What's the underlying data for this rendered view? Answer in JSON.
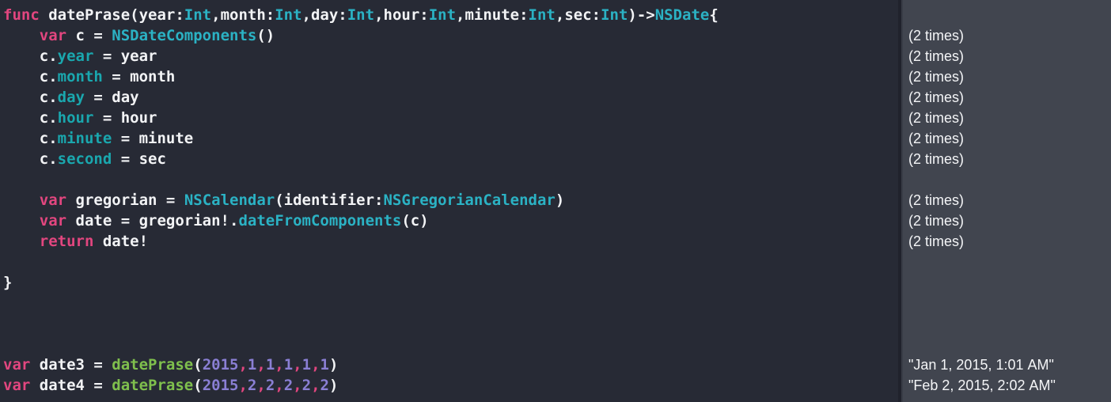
{
  "window": {
    "kind": "swift-playground",
    "editor_background": "#272a35",
    "sidebar_background": "#41454f",
    "divider_color": "#20222c"
  },
  "theme": {
    "keyword": "#e2467f",
    "type": "#2bb2c4",
    "property": "#1aa7ae",
    "function_call": "#7fbf4d",
    "number": "#8a7fd4",
    "plain_text": "#f2f3f5",
    "result_text": "#f4f5f7"
  },
  "editor": {
    "language": "Swift",
    "lines": [
      {
        "n": 1,
        "indent": 0,
        "tokens": [
          {
            "t": "func",
            "c": "kw"
          },
          {
            "t": " datePrase(year:",
            "c": "plain"
          },
          {
            "t": "Int",
            "c": "type"
          },
          {
            "t": ",month:",
            "c": "plain"
          },
          {
            "t": "Int",
            "c": "type"
          },
          {
            "t": ",day:",
            "c": "plain"
          },
          {
            "t": "Int",
            "c": "type"
          },
          {
            "t": ",hour:",
            "c": "plain"
          },
          {
            "t": "Int",
            "c": "type"
          },
          {
            "t": ",minute:",
            "c": "plain"
          },
          {
            "t": "Int",
            "c": "type"
          },
          {
            "t": ",sec:",
            "c": "plain"
          },
          {
            "t": "Int",
            "c": "type"
          },
          {
            "t": ")->",
            "c": "plain"
          },
          {
            "t": "NSDate",
            "c": "type"
          },
          {
            "t": "{",
            "c": "plain"
          }
        ]
      },
      {
        "n": 2,
        "indent": 4,
        "tokens": [
          {
            "t": "var",
            "c": "kw"
          },
          {
            "t": " c = ",
            "c": "plain"
          },
          {
            "t": "NSDateComponents",
            "c": "type"
          },
          {
            "t": "()",
            "c": "plain"
          }
        ]
      },
      {
        "n": 3,
        "indent": 4,
        "tokens": [
          {
            "t": "c.",
            "c": "plain"
          },
          {
            "t": "year",
            "c": "prop"
          },
          {
            "t": " = year",
            "c": "plain"
          }
        ]
      },
      {
        "n": 4,
        "indent": 4,
        "tokens": [
          {
            "t": "c.",
            "c": "plain"
          },
          {
            "t": "month",
            "c": "prop"
          },
          {
            "t": " = month",
            "c": "plain"
          }
        ]
      },
      {
        "n": 5,
        "indent": 4,
        "tokens": [
          {
            "t": "c.",
            "c": "plain"
          },
          {
            "t": "day",
            "c": "prop"
          },
          {
            "t": " = day",
            "c": "plain"
          }
        ]
      },
      {
        "n": 6,
        "indent": 4,
        "tokens": [
          {
            "t": "c.",
            "c": "plain"
          },
          {
            "t": "hour",
            "c": "prop"
          },
          {
            "t": " = hour",
            "c": "plain"
          }
        ]
      },
      {
        "n": 7,
        "indent": 4,
        "tokens": [
          {
            "t": "c.",
            "c": "plain"
          },
          {
            "t": "minute",
            "c": "prop"
          },
          {
            "t": " = minute",
            "c": "plain"
          }
        ]
      },
      {
        "n": 8,
        "indent": 4,
        "tokens": [
          {
            "t": "c.",
            "c": "plain"
          },
          {
            "t": "second",
            "c": "prop"
          },
          {
            "t": " = sec",
            "c": "plain"
          }
        ]
      },
      {
        "n": 9,
        "indent": 0,
        "tokens": []
      },
      {
        "n": 10,
        "indent": 4,
        "tokens": [
          {
            "t": "var",
            "c": "kw"
          },
          {
            "t": " gregorian = ",
            "c": "plain"
          },
          {
            "t": "NSCalendar",
            "c": "type"
          },
          {
            "t": "(identifier:",
            "c": "plain"
          },
          {
            "t": "NSGregorianCalendar",
            "c": "type"
          },
          {
            "t": ")",
            "c": "plain"
          }
        ]
      },
      {
        "n": 11,
        "indent": 4,
        "tokens": [
          {
            "t": "var",
            "c": "kw"
          },
          {
            "t": " date = gregorian!.",
            "c": "plain"
          },
          {
            "t": "dateFromComponents",
            "c": "type"
          },
          {
            "t": "(c)",
            "c": "plain"
          }
        ]
      },
      {
        "n": 12,
        "indent": 4,
        "tokens": [
          {
            "t": "return",
            "c": "kw"
          },
          {
            "t": " date!",
            "c": "plain"
          }
        ]
      },
      {
        "n": 13,
        "indent": 0,
        "tokens": []
      },
      {
        "n": 14,
        "indent": 0,
        "tokens": [
          {
            "t": "}",
            "c": "plain"
          }
        ]
      },
      {
        "n": 15,
        "indent": 0,
        "tokens": []
      },
      {
        "n": 16,
        "indent": 0,
        "tokens": []
      },
      {
        "n": 17,
        "indent": 0,
        "tokens": []
      },
      {
        "n": 18,
        "indent": 0,
        "tokens": [
          {
            "t": "var",
            "c": "kw"
          },
          {
            "t": " date3 = ",
            "c": "plain"
          },
          {
            "t": "datePrase",
            "c": "call"
          },
          {
            "t": "(",
            "c": "plain"
          },
          {
            "t": "2015",
            "c": "num"
          },
          {
            "t": ",",
            "c": "comma"
          },
          {
            "t": "1",
            "c": "num"
          },
          {
            "t": ",",
            "c": "comma"
          },
          {
            "t": "1",
            "c": "num"
          },
          {
            "t": ",",
            "c": "comma"
          },
          {
            "t": "1",
            "c": "num"
          },
          {
            "t": ",",
            "c": "comma"
          },
          {
            "t": "1",
            "c": "num"
          },
          {
            "t": ",",
            "c": "comma"
          },
          {
            "t": "1",
            "c": "num"
          },
          {
            "t": ")",
            "c": "plain"
          }
        ]
      },
      {
        "n": 19,
        "indent": 0,
        "tokens": [
          {
            "t": "var",
            "c": "kw"
          },
          {
            "t": " date4 = ",
            "c": "plain"
          },
          {
            "t": "datePrase",
            "c": "call"
          },
          {
            "t": "(",
            "c": "plain"
          },
          {
            "t": "2015",
            "c": "num"
          },
          {
            "t": ",",
            "c": "comma"
          },
          {
            "t": "2",
            "c": "num"
          },
          {
            "t": ",",
            "c": "comma"
          },
          {
            "t": "2",
            "c": "num"
          },
          {
            "t": ",",
            "c": "comma"
          },
          {
            "t": "2",
            "c": "num"
          },
          {
            "t": ",",
            "c": "comma"
          },
          {
            "t": "2",
            "c": "num"
          },
          {
            "t": ",",
            "c": "comma"
          },
          {
            "t": "2",
            "c": "num"
          },
          {
            "t": ")",
            "c": "plain"
          }
        ]
      }
    ]
  },
  "sidebar": {
    "results": [
      {
        "n": 1,
        "text": ""
      },
      {
        "n": 2,
        "text": "(2 times)"
      },
      {
        "n": 3,
        "text": "(2 times)"
      },
      {
        "n": 4,
        "text": "(2 times)"
      },
      {
        "n": 5,
        "text": "(2 times)"
      },
      {
        "n": 6,
        "text": "(2 times)"
      },
      {
        "n": 7,
        "text": "(2 times)"
      },
      {
        "n": 8,
        "text": "(2 times)"
      },
      {
        "n": 9,
        "text": ""
      },
      {
        "n": 10,
        "text": "(2 times)"
      },
      {
        "n": 11,
        "text": "(2 times)"
      },
      {
        "n": 12,
        "text": "(2 times)"
      },
      {
        "n": 13,
        "text": ""
      },
      {
        "n": 14,
        "text": ""
      },
      {
        "n": 15,
        "text": ""
      },
      {
        "n": 16,
        "text": ""
      },
      {
        "n": 17,
        "text": ""
      },
      {
        "n": 18,
        "text": "\"Jan 1, 2015, 1:01 AM\""
      },
      {
        "n": 19,
        "text": "\"Feb 2, 2015, 2:02 AM\""
      }
    ]
  }
}
